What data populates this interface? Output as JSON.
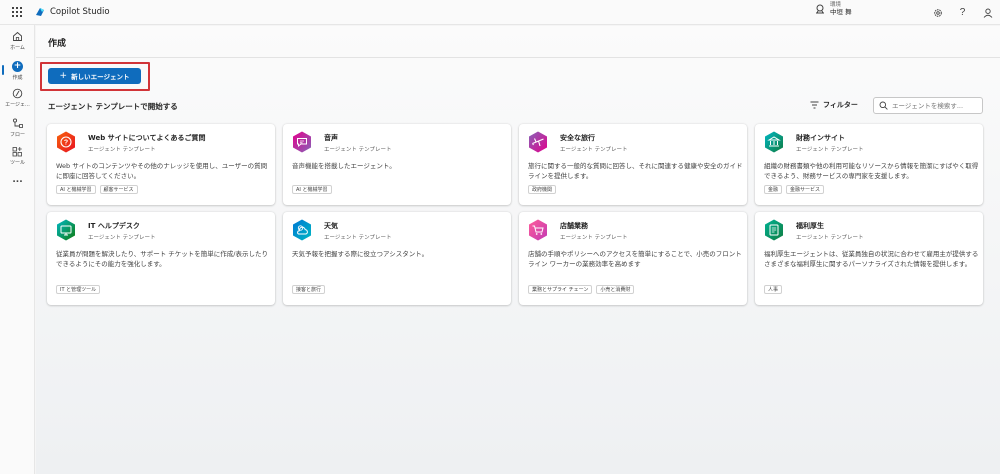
{
  "app": {
    "name": "Copilot Studio"
  },
  "environment": {
    "label": "環境",
    "name": "中垣 舞"
  },
  "rail": {
    "items": [
      {
        "label": "ホーム",
        "icon": "home-icon"
      },
      {
        "label": "作成",
        "icon": "plus-circle-icon"
      },
      {
        "label": "エージェ...",
        "icon": "agent-icon"
      },
      {
        "label": "フロー",
        "icon": "flow-icon"
      },
      {
        "label": "ツール",
        "icon": "tools-icon"
      },
      {
        "label": "...",
        "icon": "more-icon"
      }
    ]
  },
  "page": {
    "title": "作成",
    "new_agent_button": "新しいエージェント",
    "section_title": "エージェント テンプレートで開始する",
    "filter_label": "フィルター",
    "search_placeholder": "エージェントを検索す..."
  },
  "templates": [
    {
      "title": "Web サイトについてよくあるご質問",
      "subtitle": "エージェント テンプレート",
      "description": "Web サイトのコンテンツやその他のナレッジを使用し、ユーザーの質問に即座に回答してください。",
      "tags": [
        "AI と機械学習",
        "顧客サービス"
      ],
      "icon": "faq-icon",
      "color_from": "#f7630c",
      "color_to": "#e81123"
    },
    {
      "title": "音声",
      "subtitle": "エージェント テンプレート",
      "description": "音声機能を搭載したエージェント。",
      "tags": [
        "AI と機械学習"
      ],
      "icon": "voice-chat-icon",
      "color_from": "#e3008c",
      "color_to": "#8764b8"
    },
    {
      "title": "安全な旅行",
      "subtitle": "エージェント テンプレート",
      "description": "旅行に関する一般的な質問に回答し、それに関連する健康や安全のガイドラインを提供します。",
      "tags": [
        "政府機関"
      ],
      "icon": "airplane-icon",
      "color_from": "#8764b8",
      "color_to": "#e3008c"
    },
    {
      "title": "財務インサイト",
      "subtitle": "エージェント テンプレート",
      "description": "組織の財務書類や他の利用可能なリソースから情報を簡潔にすばやく取得できるよう、財務サービスの専門家を支援します。",
      "tags": [
        "金融",
        "金融サービス"
      ],
      "icon": "bank-icon",
      "color_from": "#00b7c3",
      "color_to": "#107c41"
    },
    {
      "title": "IT ヘルプデスク",
      "subtitle": "エージェント テンプレート",
      "description": "従業員が問題を解決したり、サポート チケットを簡単に作成/表示したりできるようにその能力を強化します。",
      "tags": [
        "IT と管理ツール"
      ],
      "icon": "monitor-icon",
      "color_from": "#00b7c3",
      "color_to": "#107c10"
    },
    {
      "title": "天気",
      "subtitle": "エージェント テンプレート",
      "description": "天気予報を把握する際に役立つアシスタント。",
      "tags": [
        "接客と旅行"
      ],
      "icon": "weather-icon",
      "color_from": "#0078d4",
      "color_to": "#00b7c3"
    },
    {
      "title": "店舗業務",
      "subtitle": "エージェント テンプレート",
      "description": "店舗の手順やポリシーへのアクセスを簡単にすることで、小売のフロントライン ワーカーの業務効率を高めます",
      "tags": [
        "業務とサプライ チェーン",
        "小売と消費財"
      ],
      "icon": "cart-icon",
      "color_from": "#ff5c9a",
      "color_to": "#c239b3"
    },
    {
      "title": "福利厚生",
      "subtitle": "エージェント テンプレート",
      "description": "福利厚生エージェントは、従業員独自の状況に合わせて雇用主が提供するさまざまな福利厚生に関するパーソナライズされた情報を提供します。",
      "tags": [
        "人事"
      ],
      "icon": "document-icon",
      "color_from": "#00b294",
      "color_to": "#107c41"
    }
  ]
}
